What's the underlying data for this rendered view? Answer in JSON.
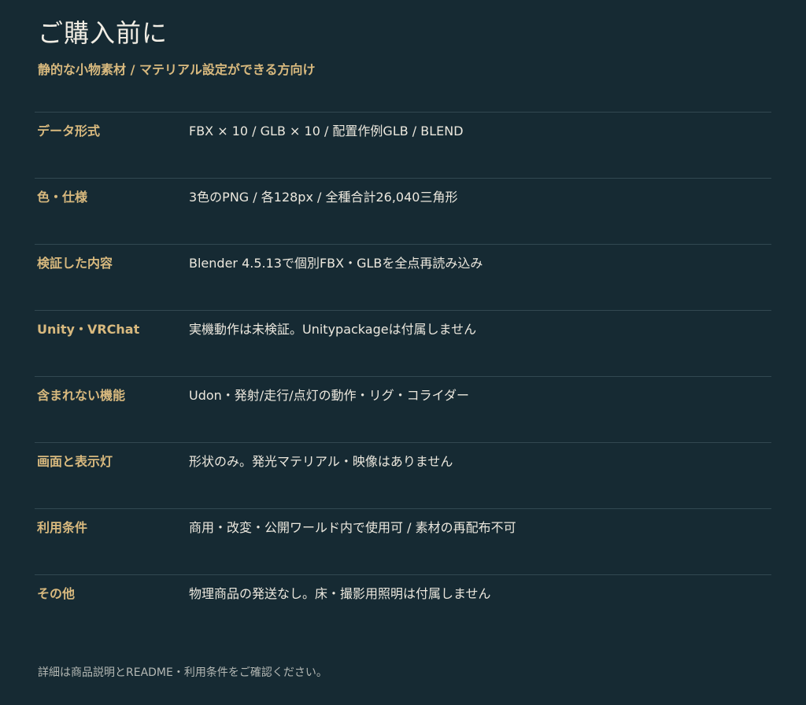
{
  "header": {
    "title": "ご購入前に",
    "subtitle": "静的な小物素材 / マテリアル設定ができる方向け"
  },
  "specs": [
    {
      "label": "データ形式",
      "value": "FBX × 10 / GLB × 10 / 配置作例GLB / BLEND"
    },
    {
      "label": "色・仕様",
      "value": "3色のPNG / 各128px / 全種合計26,040三角形"
    },
    {
      "label": "検証した内容",
      "value": "Blender 4.5.13で個別FBX・GLBを全点再読み込み"
    },
    {
      "label": "Unity・VRChat",
      "value": "実機動作は未検証。Unitypackageは付属しません"
    },
    {
      "label": "含まれない機能",
      "value": "Udon・発射/走行/点灯の動作・リグ・コライダー"
    },
    {
      "label": "画面と表示灯",
      "value": "形状のみ。発光マテリアル・映像はありません"
    },
    {
      "label": "利用条件",
      "value": "商用・改変・公開ワールド内で使用可 / 素材の再配布不可"
    },
    {
      "label": "その他",
      "value": "物理商品の発送なし。床・撮影用照明は付属しません"
    }
  ],
  "footer": {
    "note": "詳細は商品説明とREADME・利用条件をご確認ください。"
  }
}
